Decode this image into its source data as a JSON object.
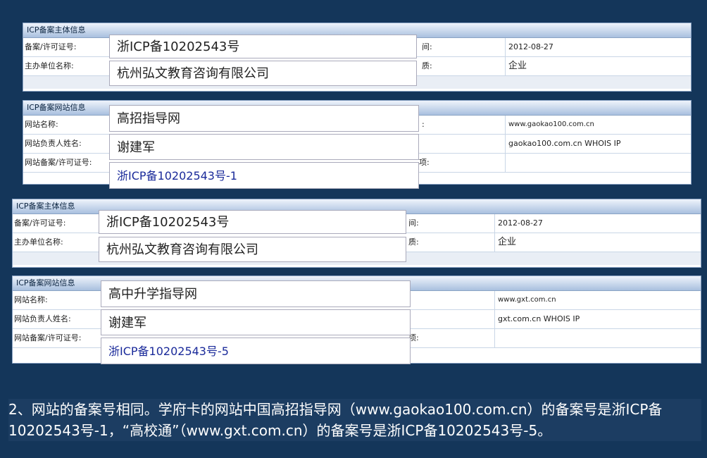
{
  "labels": {
    "main_header": "ICP备案主体信息",
    "site_header": "ICP备案网站信息",
    "reg_no": "备案/许可证号:",
    "org_name": "主办单位名称:",
    "site_name": "网站名称:",
    "site_owner": "网站负责人姓名:",
    "site_reg": "网站备案/许可证号:",
    "frag_time": "间:",
    "frag_type": "质:",
    "frag_domain": ":",
    "frag_item": "项:"
  },
  "record1": {
    "reg_no": "浙ICP备10202543号",
    "org_name": "杭州弘文教育咨询有限公司",
    "date": "2012-08-27",
    "org_type": "企业",
    "site_name": "高招指导网",
    "owner": "谢建军",
    "site_reg": "浙ICP备10202543号-1",
    "home_url": "www.gaokao100.com.cn",
    "domain": "gaokao100.com.cn WHOIS IP"
  },
  "record2": {
    "reg_no": "浙ICP备10202543号",
    "org_name": "杭州弘文教育咨询有限公司",
    "date": "2012-08-27",
    "org_type": "企业",
    "site_name": "高中升学指导网",
    "owner": "谢建军",
    "site_reg": "浙ICP备10202543号-5",
    "home_url": "www.gxt.com.cn",
    "domain": "gxt.com.cn WHOIS IP"
  },
  "caption": "2、网站的备案号相同。学府卡的网站中国高招指导网（www.gaokao100.com.cn）的备案号是浙ICP备10202543号-1，“高校通”（www.gxt.com.cn）的备案号是浙ICP备10202543号-5。"
}
